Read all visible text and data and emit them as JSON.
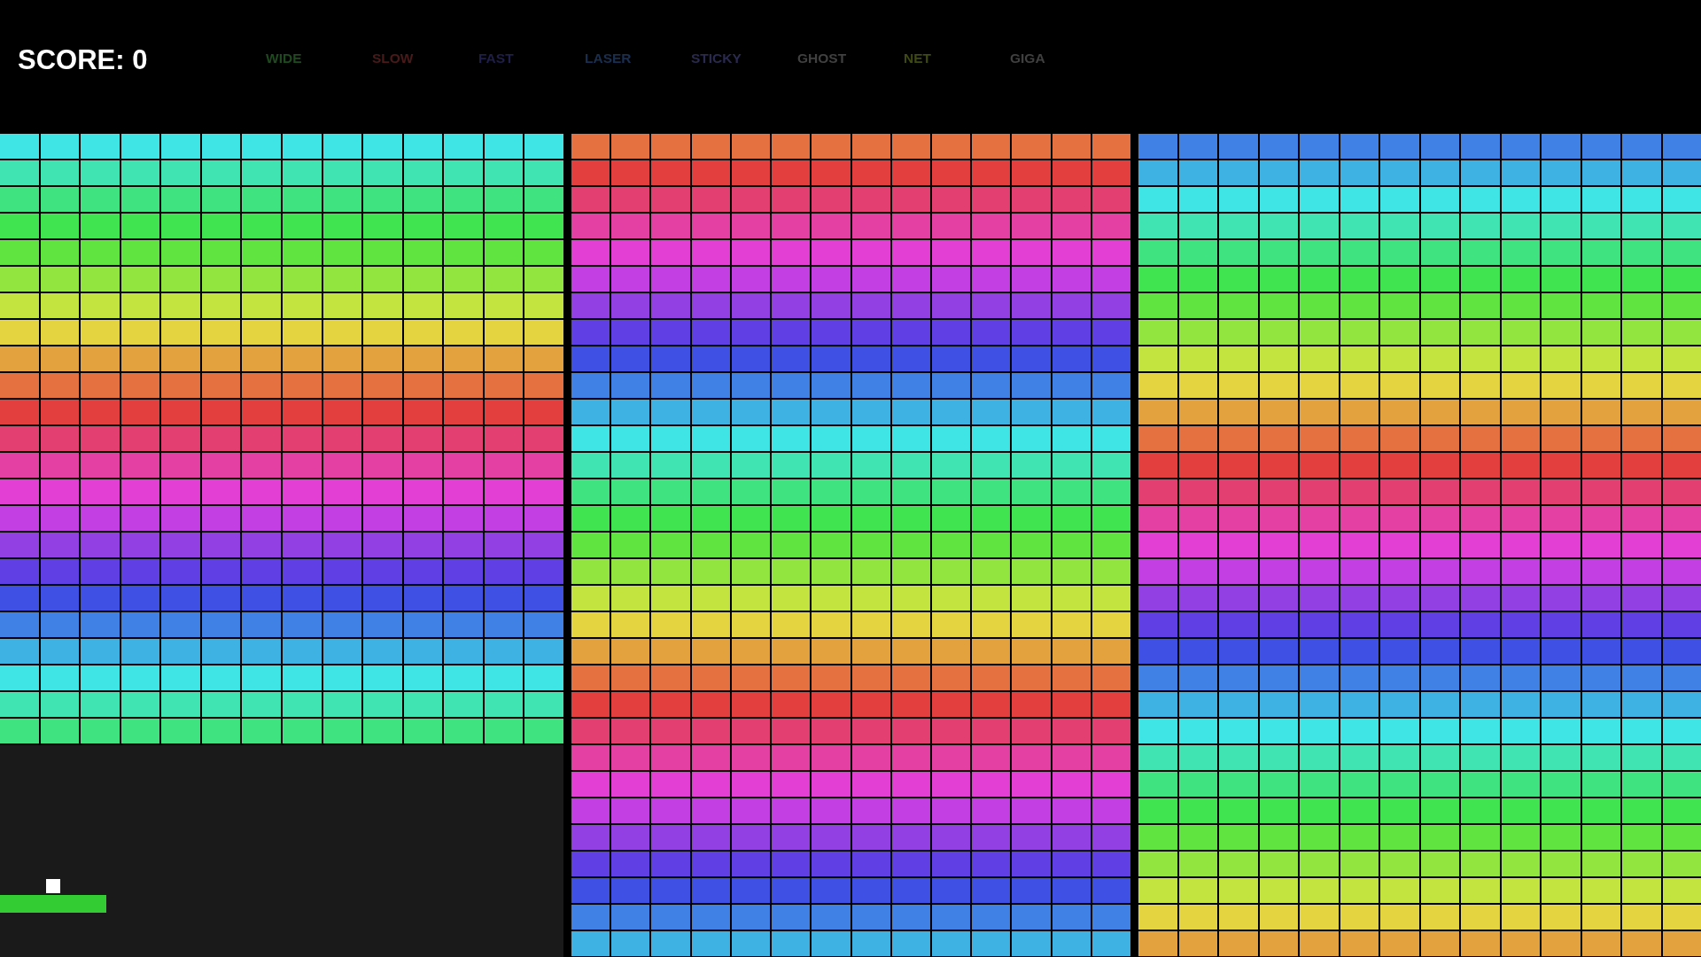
{
  "score": "SCORE: 0",
  "powerups": [
    {
      "label": "WIDE",
      "color": "#1f4a1f",
      "active": false
    },
    {
      "label": "SLOW",
      "color": "#4a1a1a",
      "active": false
    },
    {
      "label": "FAST",
      "color": "#1f1f4a",
      "active": false
    },
    {
      "label": "LASER",
      "color": "#1a2f4f",
      "active": false
    },
    {
      "label": "STICKY",
      "color": "#2a2a4f",
      "active": false
    },
    {
      "label": "GHOST",
      "color": "#404040",
      "active": false
    },
    {
      "label": "NET",
      "color": "#3f4a12",
      "active": false
    },
    {
      "label": "GIGA",
      "color": "#404040",
      "active": false
    }
  ],
  "panels": [
    {
      "rows": [
        {
          "color": "#3fe4e4"
        },
        {
          "color": "#3fe4b2"
        },
        {
          "color": "#3fe481"
        },
        {
          "color": "#3fe450"
        },
        {
          "color": "#60e43f"
        },
        {
          "color": "#92e43f"
        },
        {
          "color": "#c3e43f"
        },
        {
          "color": "#e4d43f"
        },
        {
          "color": "#e4a23f"
        },
        {
          "color": "#e4713f"
        },
        {
          "color": "#e43f3f"
        },
        {
          "color": "#e43f71"
        },
        {
          "color": "#e43fa2"
        },
        {
          "color": "#e43fd4"
        },
        {
          "color": "#c33fe4"
        },
        {
          "color": "#923fe4"
        },
        {
          "color": "#603fe4"
        },
        {
          "color": "#3f50e4"
        },
        {
          "color": "#3f81e4"
        },
        {
          "color": "#3fb2e4"
        },
        {
          "color": "#3fe4e4"
        },
        {
          "color": "#3fe4b2"
        },
        {
          "color": "#3fe481"
        }
      ]
    },
    {
      "rows": [
        {
          "color": "#e4713f"
        },
        {
          "color": "#e43f3f"
        },
        {
          "color": "#e43f71"
        },
        {
          "color": "#e43fa2"
        },
        {
          "color": "#e43fd4"
        },
        {
          "color": "#c33fe4"
        },
        {
          "color": "#923fe4"
        },
        {
          "color": "#603fe4"
        },
        {
          "color": "#3f50e4"
        },
        {
          "color": "#3f81e4"
        },
        {
          "color": "#3fb2e4"
        },
        {
          "color": "#3fe4e4"
        },
        {
          "color": "#3fe4b2"
        },
        {
          "color": "#3fe481"
        },
        {
          "color": "#3fe450"
        },
        {
          "color": "#60e43f"
        },
        {
          "color": "#92e43f"
        },
        {
          "color": "#c3e43f"
        },
        {
          "color": "#e4d43f"
        },
        {
          "color": "#e4a23f"
        },
        {
          "color": "#e4713f"
        },
        {
          "color": "#e43f3f"
        },
        {
          "color": "#e43f71"
        },
        {
          "color": "#e43fa2"
        },
        {
          "color": "#e43fd4"
        },
        {
          "color": "#c33fe4"
        },
        {
          "color": "#923fe4"
        },
        {
          "color": "#603fe4"
        },
        {
          "color": "#3f50e4"
        },
        {
          "color": "#3f81e4"
        },
        {
          "color": "#3fb2e4"
        }
      ]
    },
    {
      "rows": [
        {
          "color": "#3f81e4"
        },
        {
          "color": "#3fb2e4"
        },
        {
          "color": "#3fe4e4"
        },
        {
          "color": "#3fe4b2"
        },
        {
          "color": "#3fe481"
        },
        {
          "color": "#3fe450"
        },
        {
          "color": "#60e43f"
        },
        {
          "color": "#92e43f"
        },
        {
          "color": "#c3e43f"
        },
        {
          "color": "#e4d43f"
        },
        {
          "color": "#e4a23f"
        },
        {
          "color": "#e4713f"
        },
        {
          "color": "#e43f3f"
        },
        {
          "color": "#e43f71"
        },
        {
          "color": "#e43fa2"
        },
        {
          "color": "#e43fd4"
        },
        {
          "color": "#c33fe4"
        },
        {
          "color": "#923fe4"
        },
        {
          "color": "#603fe4"
        },
        {
          "color": "#3f50e4"
        },
        {
          "color": "#3f81e4"
        },
        {
          "color": "#3fb2e4"
        },
        {
          "color": "#3fe4e4"
        },
        {
          "color": "#3fe4b2"
        },
        {
          "color": "#3fe481"
        },
        {
          "color": "#3fe450"
        },
        {
          "color": "#60e43f"
        },
        {
          "color": "#92e43f"
        },
        {
          "color": "#c3e43f"
        },
        {
          "color": "#e4d43f"
        },
        {
          "color": "#e4a23f"
        }
      ]
    }
  ]
}
